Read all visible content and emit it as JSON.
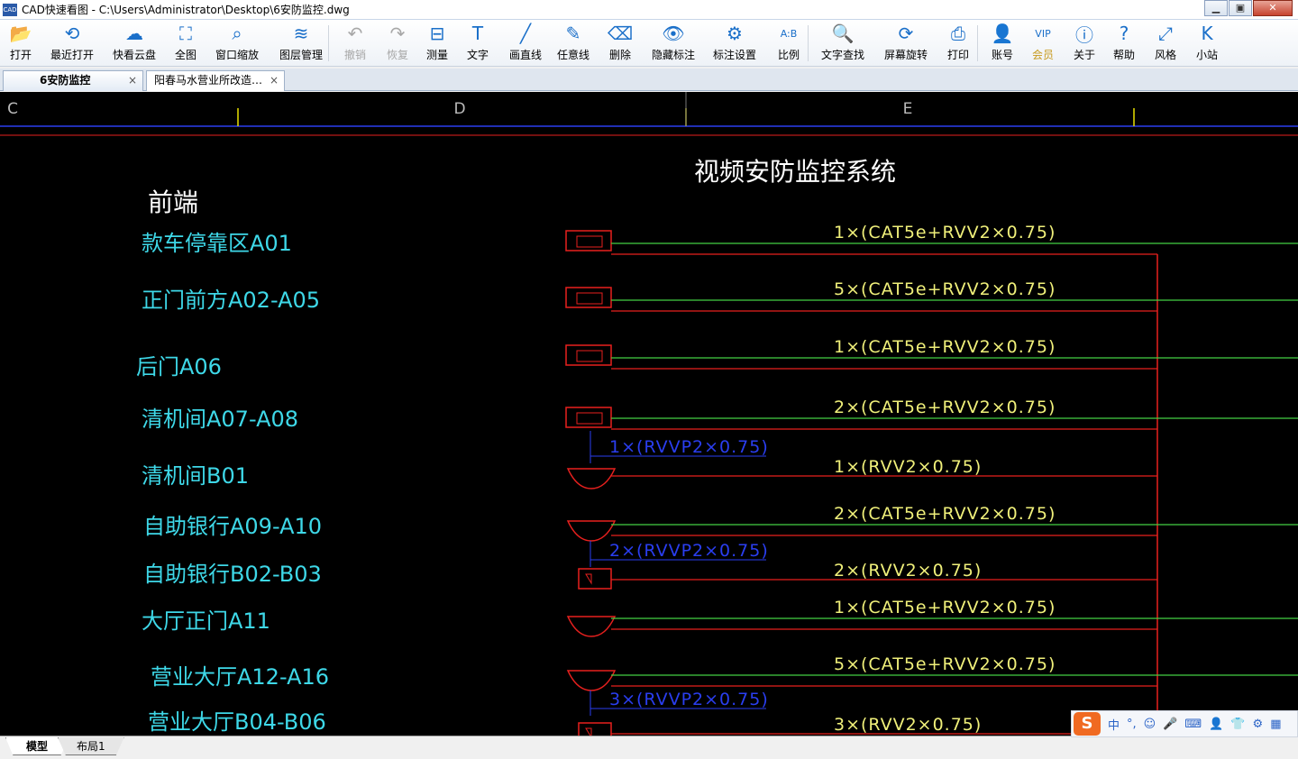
{
  "window": {
    "title": "CAD快速看图 - C:\\Users\\Administrator\\Desktop\\6安防监控.dwg",
    "app_icon": "CAD"
  },
  "window_buttons": {
    "minimize": "▁",
    "maximize": "▣",
    "close": "✕"
  },
  "toolbar": [
    {
      "name": "open",
      "label": "打开",
      "icon": "📂"
    },
    {
      "name": "recent-open",
      "label": "最近打开",
      "icon": "⟲"
    },
    {
      "name": "cloud",
      "label": "快看云盘",
      "icon": "☁"
    },
    {
      "name": "full-view",
      "label": "全图",
      "icon": "⛶"
    },
    {
      "name": "window-zoom",
      "label": "窗口缩放",
      "icon": "⌕"
    },
    {
      "name": "layer-manage",
      "label": "图层管理",
      "icon": "≋"
    },
    {
      "name": "undo",
      "label": "撤销",
      "icon": "↶"
    },
    {
      "name": "redo",
      "label": "恢复",
      "icon": "↷"
    },
    {
      "name": "measure",
      "label": "测量",
      "icon": "⊟"
    },
    {
      "name": "text",
      "label": "文字",
      "icon": "T"
    },
    {
      "name": "draw-line",
      "label": "画直线",
      "icon": "╱"
    },
    {
      "name": "freehand",
      "label": "任意线",
      "icon": "✎"
    },
    {
      "name": "delete",
      "label": "删除",
      "icon": "⌫"
    },
    {
      "name": "hide-annotation",
      "label": "隐藏标注",
      "icon": "👁"
    },
    {
      "name": "annotation-settings",
      "label": "标注设置",
      "icon": "⚙"
    },
    {
      "name": "scale",
      "label": "比例",
      "icon": "A:B"
    },
    {
      "name": "text-search",
      "label": "文字查找",
      "icon": "🔍"
    },
    {
      "name": "rotate-screen",
      "label": "屏幕旋转",
      "icon": "⟳"
    },
    {
      "name": "print",
      "label": "打印",
      "icon": "⎙"
    },
    {
      "name": "account",
      "label": "账号",
      "icon": "👤"
    },
    {
      "name": "member",
      "label": "会员",
      "icon": "VIP"
    },
    {
      "name": "about",
      "label": "关于",
      "icon": "ⓘ"
    },
    {
      "name": "help",
      "label": "帮助",
      "icon": "?"
    },
    {
      "name": "style",
      "label": "风格",
      "icon": "⤢"
    },
    {
      "name": "site",
      "label": "小站",
      "icon": "K"
    }
  ],
  "doc_tabs": [
    {
      "label": "6安防监控",
      "close": "×"
    },
    {
      "label": "阳春马水营业所改造…",
      "close": "×"
    }
  ],
  "drawing": {
    "grid_columns": [
      "C",
      "D",
      "E"
    ],
    "title": "视频安防监控系统",
    "section_label": "前端",
    "rows": [
      {
        "label": "款车停靠区A01",
        "cable": "1×(CAT5e+RVV2×0.75)"
      },
      {
        "label": "正门前方A02-A05",
        "cable": "5×(CAT5e+RVV2×0.75)"
      },
      {
        "label": "后门A06",
        "cable": "1×(CAT5e+RVV2×0.75)"
      },
      {
        "label": "清机间A07-A08",
        "cable": "2×(CAT5e+RVV2×0.75)",
        "sub_cable": "1×(RVVP2×0.75)"
      },
      {
        "label": "清机间B01",
        "cable": "1×(RVV2×0.75)"
      },
      {
        "label": "自助银行A09-A10",
        "cable": "2×(CAT5e+RVV2×0.75)",
        "sub_cable": "2×(RVVP2×0.75)"
      },
      {
        "label": "自助银行B02-B03",
        "cable": "2×(RVV2×0.75)"
      },
      {
        "label": "大厅正门A11",
        "cable": "1×(CAT5e+RVV2×0.75)"
      },
      {
        "label": "营业大厅A12-A16",
        "cable": "5×(CAT5e+RVV2×0.75)",
        "sub_cable": "3×(RVVP2×0.75)"
      },
      {
        "label": "营业大厅B04-B06",
        "cable": "3×(RVV2×0.75)"
      }
    ],
    "colors": {
      "label": "#3ed8e8",
      "cable_text": "#f0f07a",
      "line_red": "#e8201e",
      "line_green": "#44d044",
      "line_blue": "#2a3ef0",
      "grid_yellow": "#e8e000",
      "title": "#ffffff"
    }
  },
  "layout_tabs": [
    "模型",
    "布局1"
  ],
  "ime": {
    "logo": "S",
    "lang": "中",
    "items": [
      "°,",
      "☺",
      "🎤",
      "⌨",
      "👤",
      "👕",
      "⚙",
      "▦"
    ]
  }
}
